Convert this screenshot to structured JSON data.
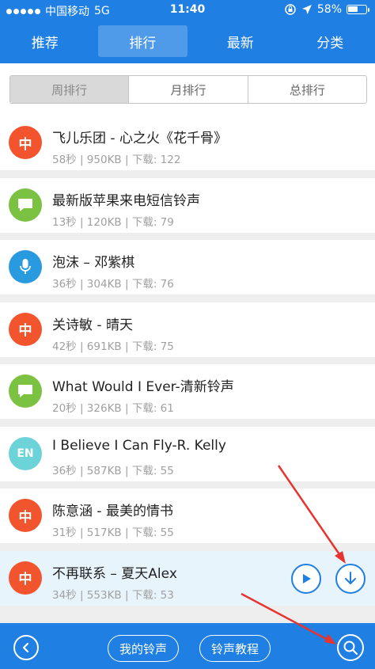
{
  "status_bar": {
    "carrier": "中国移动",
    "network": "5G",
    "time": "11:40",
    "battery_percent": "58%",
    "battery_level": 0.58
  },
  "nav": {
    "tabs": [
      {
        "label": "推荐",
        "active": false
      },
      {
        "label": "排行",
        "active": true
      },
      {
        "label": "最新",
        "active": false
      },
      {
        "label": "分类",
        "active": false
      }
    ]
  },
  "ranking_filter": {
    "options": [
      {
        "label": "周排行",
        "active": true
      },
      {
        "label": "月排行",
        "active": false
      },
      {
        "label": "总排行",
        "active": false
      }
    ]
  },
  "ringtones": [
    {
      "title": "飞儿乐团 - 心之火《花千骨》",
      "meta": "58秒 | 950KB | 下载: 122",
      "icon": "chinese-icon",
      "color": "#f2542d",
      "badge": "中"
    },
    {
      "title": "最新版苹果来电短信铃声",
      "meta": "13秒 | 120KB | 下载: 79",
      "icon": "message-icon",
      "color": "#7cc242",
      "badge": ""
    },
    {
      "title": "泡沫 – 邓紫棋",
      "meta": "36秒 | 304KB | 下载: 76",
      "icon": "microphone-icon",
      "color": "#2a9ae0",
      "badge": ""
    },
    {
      "title": "关诗敏 - 晴天",
      "meta": "42秒 | 691KB | 下载: 75",
      "icon": "chinese-icon",
      "color": "#f2542d",
      "badge": "中"
    },
    {
      "title": "What Would I Ever-清新铃声",
      "meta": "20秒 | 326KB | 下载: 61",
      "icon": "message-icon",
      "color": "#7cc242",
      "badge": ""
    },
    {
      "title": "I Believe I Can Fly-R. Kelly",
      "meta": "36秒 | 587KB | 下载: 55",
      "icon": "english-icon",
      "color": "#6cd3d8",
      "badge": "EN"
    },
    {
      "title": "陈意涵 - 最美的情书",
      "meta": "31秒 | 517KB | 下载: 55",
      "icon": "chinese-icon",
      "color": "#f2542d",
      "badge": "中"
    },
    {
      "title": "不再联系 – 夏天Alex",
      "meta": "34秒 | 553KB | 下载: 53",
      "icon": "chinese-icon",
      "color": "#f2542d",
      "badge": "中",
      "selected": true
    }
  ],
  "bottom_bar": {
    "my_ringtones_label": "我的铃声",
    "tutorial_label": "铃声教程"
  },
  "colors": {
    "brand_blue": "#1f7fe3",
    "annotation_red": "#e8332e"
  }
}
